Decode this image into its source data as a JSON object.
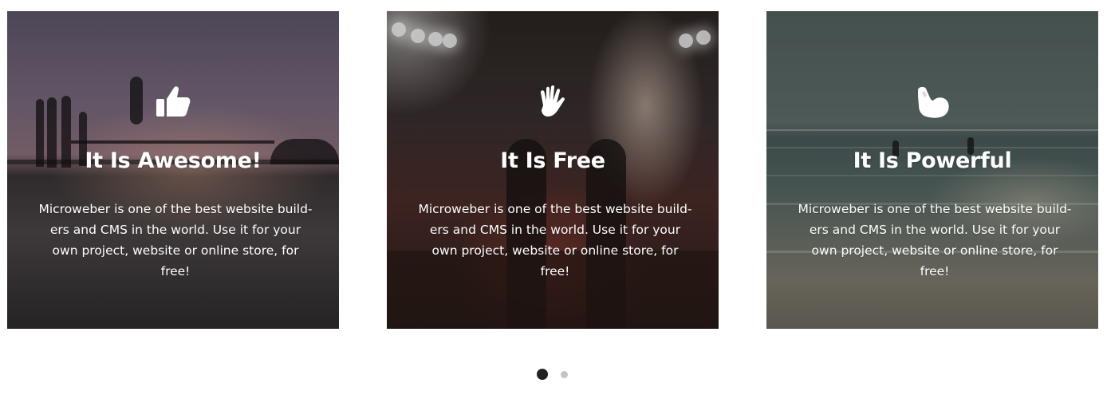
{
  "cards": [
    {
      "icon": "thumbs-up-icon",
      "title": "It Is Awesome!",
      "text": "Microweber is one of the best website build-ers and CMS in the world. Use it for your own project, website or online store, for free!"
    },
    {
      "icon": "hand-wave-icon",
      "title": "It Is Free",
      "text": "Microweber is one of the best website build-ers and CMS in the world. Use it for your own project, website or online store, for free!"
    },
    {
      "icon": "flexed-bicep-icon",
      "title": "It Is Powerful",
      "text": "Microweber is one of the best website build-ers and CMS in the world. Use it for your own project, website or online store, for free!"
    }
  ],
  "pagination": {
    "pages": 2,
    "active_page": 1
  },
  "colors": {
    "text": "#ffffff",
    "dot_active": "#222222",
    "dot_inactive": "#c4c4c4"
  }
}
